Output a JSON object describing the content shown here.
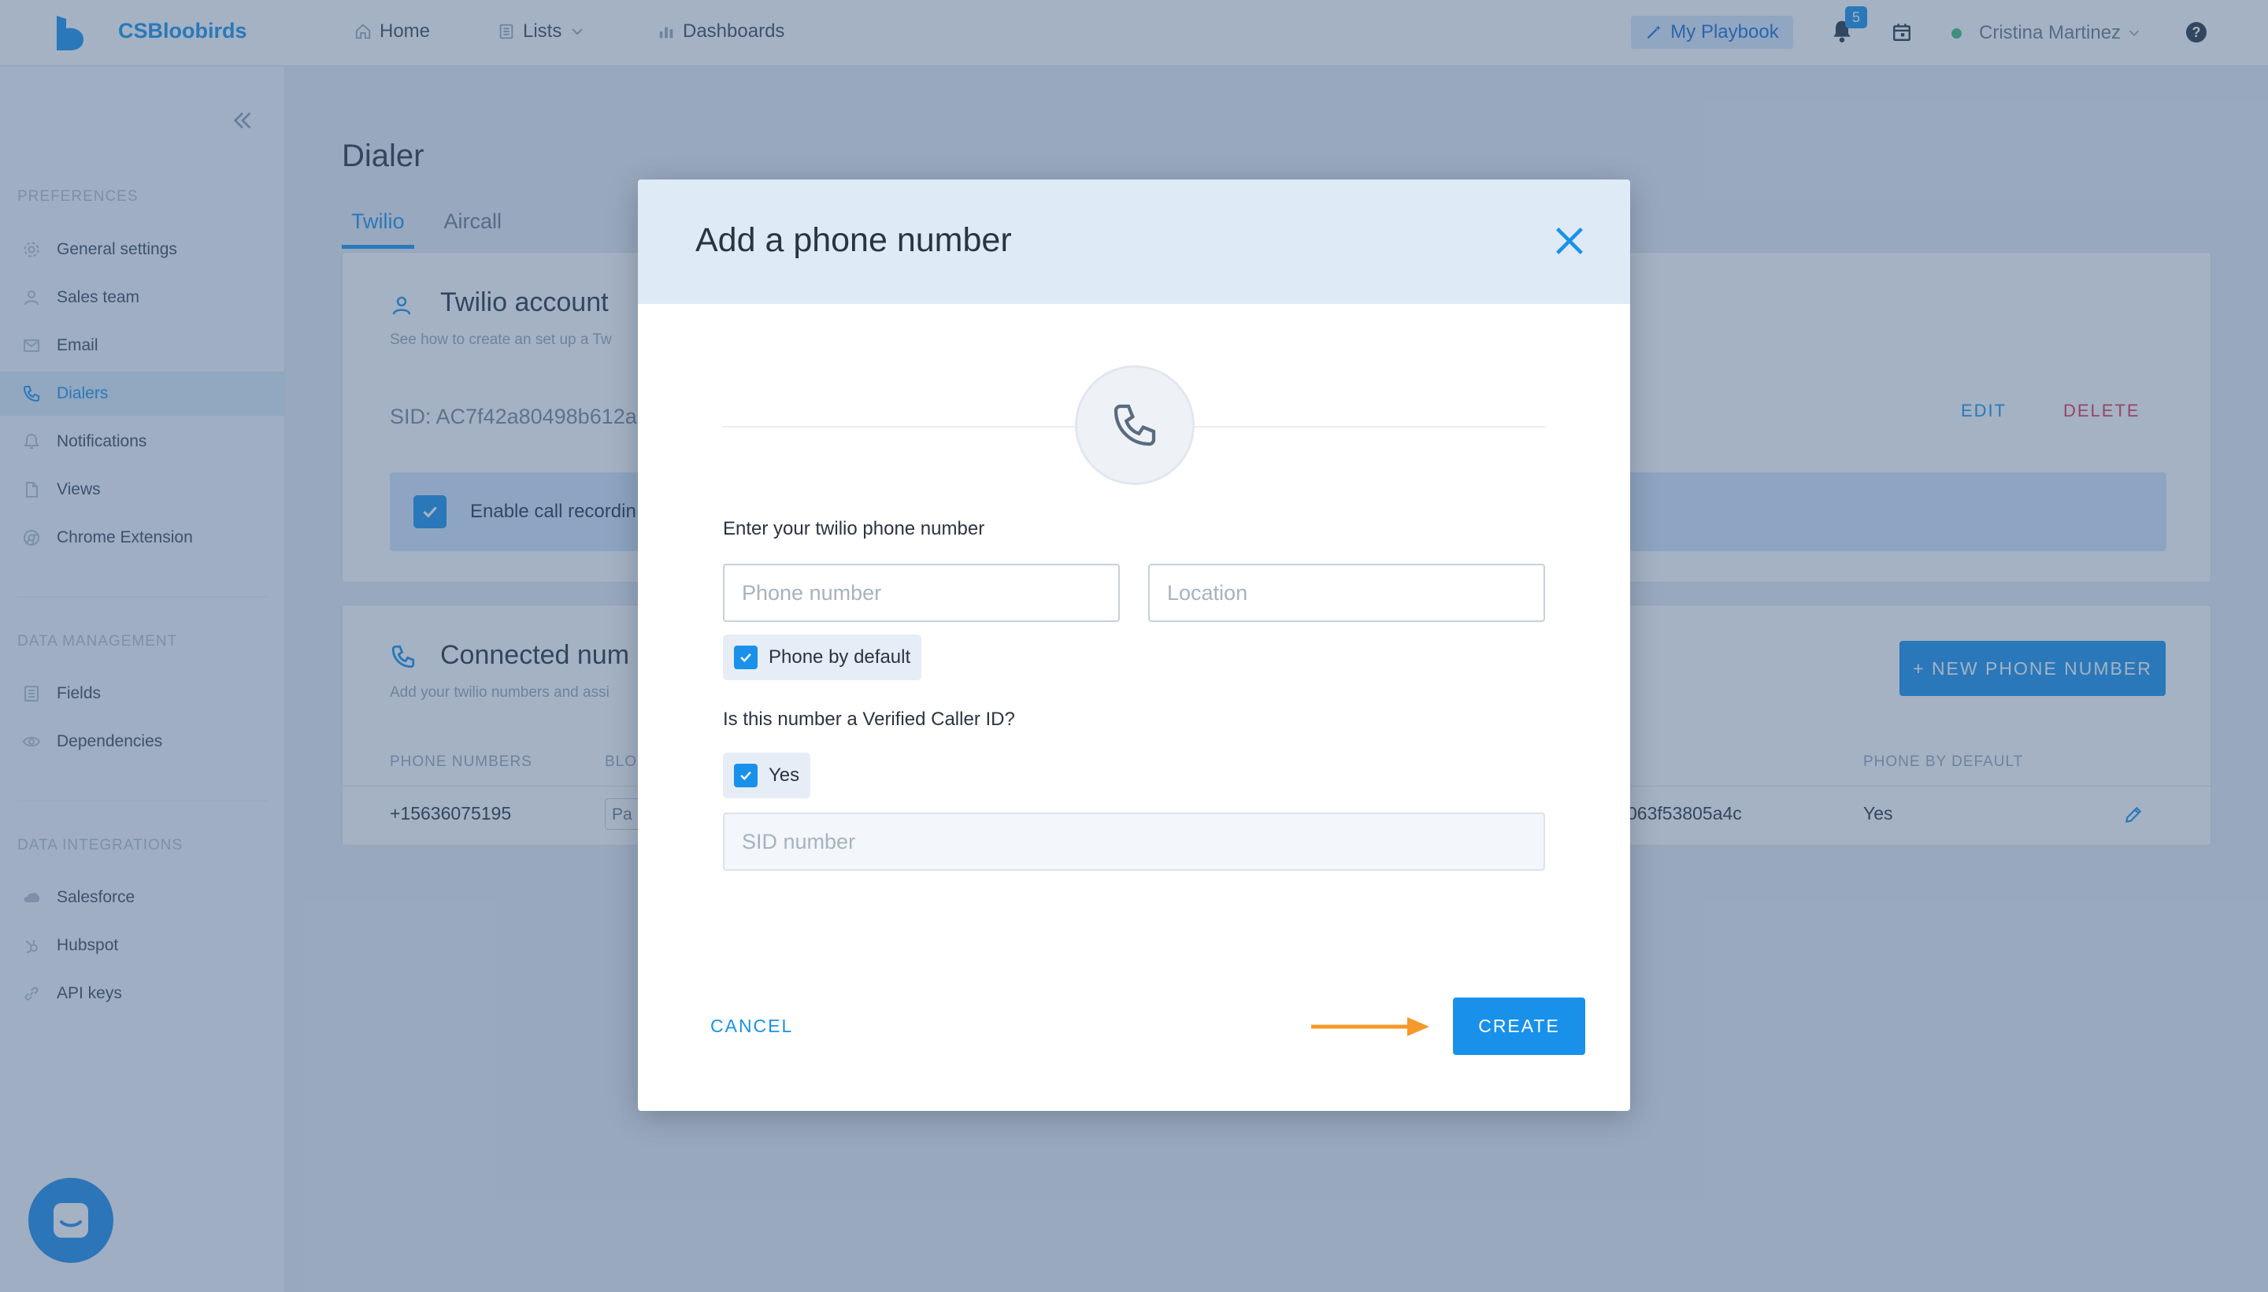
{
  "topbar": {
    "brand": "CSBloobirds",
    "nav": [
      {
        "label": "Home",
        "icon": "home-icon"
      },
      {
        "label": "Lists",
        "icon": "list-icon"
      },
      {
        "label": "Dashboards",
        "icon": "bar-chart-icon"
      }
    ],
    "playbook_label": "My Playbook",
    "notification_count": "5",
    "user_name": "Cristina Martinez",
    "help_glyph": "?"
  },
  "sidebar": {
    "sections": [
      {
        "title": "PREFERENCES",
        "items": [
          {
            "label": "General settings",
            "icon": "gear-icon"
          },
          {
            "label": "Sales team",
            "icon": "user-icon"
          },
          {
            "label": "Email",
            "icon": "envelope-icon"
          },
          {
            "label": "Dialers",
            "icon": "phone-icon",
            "active": true
          },
          {
            "label": "Notifications",
            "icon": "bell-icon"
          },
          {
            "label": "Views",
            "icon": "document-icon"
          },
          {
            "label": "Chrome Extension",
            "icon": "chrome-icon"
          }
        ]
      },
      {
        "title": "DATA MANAGEMENT",
        "items": [
          {
            "label": "Fields",
            "icon": "list-icon"
          },
          {
            "label": "Dependencies",
            "icon": "eye-icon"
          }
        ]
      },
      {
        "title": "DATA INTEGRATIONS",
        "items": [
          {
            "label": "Salesforce",
            "icon": "cloud-icon"
          },
          {
            "label": "Hubspot",
            "icon": "hubspot-icon"
          },
          {
            "label": "API keys",
            "icon": "link-icon"
          }
        ]
      }
    ]
  },
  "main": {
    "title": "Dialer",
    "tabs": [
      {
        "label": "Twilio",
        "active": true
      },
      {
        "label": "Aircall",
        "active": false
      }
    ],
    "account_card": {
      "title": "Twilio account",
      "subtitle": "See how to create an set up a Tw",
      "sid": "SID: AC7f42a80498b612a",
      "edit_label": "EDIT",
      "delete_label": "DELETE",
      "recording_label": "Enable call recordin"
    },
    "numbers_card": {
      "title": "Connected num",
      "subtitle": "Add your twilio numbers and assi",
      "new_button": "+ NEW PHONE NUMBER",
      "columns": [
        "PHONE NUMBERS",
        "BLO",
        "PHONE BY DEFAULT"
      ],
      "rows": [
        {
          "phone": "+15636075195",
          "blocked": "Pa",
          "sid_tail": "063f53805a4c",
          "default": "Yes"
        }
      ]
    }
  },
  "modal": {
    "title": "Add a phone number",
    "phone_label": "Enter your twilio phone number",
    "phone_placeholder": "Phone number",
    "location_placeholder": "Location",
    "phone_by_default_label": "Phone by default",
    "verified_label": "Is this number a Verified Caller ID?",
    "verified_yes_label": "Yes",
    "sid_placeholder": "SID number",
    "cancel_label": "CANCEL",
    "create_label": "CREATE"
  },
  "colors": {
    "accent": "#1991eb",
    "danger": "#e5334f",
    "annotation_arrow": "#f39a2b"
  }
}
